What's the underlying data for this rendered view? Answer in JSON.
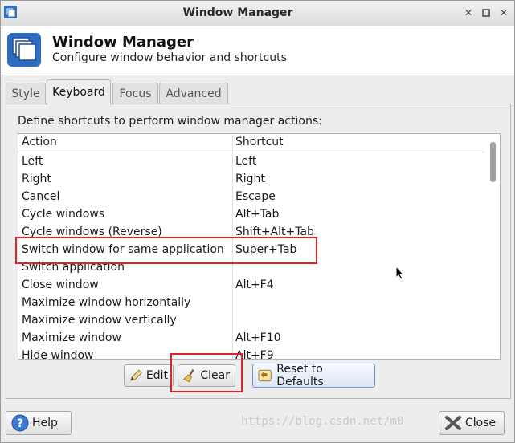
{
  "window": {
    "title": "Window Manager",
    "controls": [
      "minimize-icon",
      "maximize-icon",
      "close-icon"
    ]
  },
  "header": {
    "title": "Window Manager",
    "subtitle": "Configure window behavior and shortcuts"
  },
  "tabs": [
    {
      "label": "Style",
      "active": false
    },
    {
      "label": "Keyboard",
      "active": true
    },
    {
      "label": "Focus",
      "active": false
    },
    {
      "label": "Advanced",
      "active": false
    }
  ],
  "keyboard": {
    "description": "Define shortcuts to perform window manager actions:",
    "columns": {
      "action": "Action",
      "shortcut": "Shortcut"
    },
    "rows": [
      {
        "action": "Left",
        "shortcut": "Left"
      },
      {
        "action": "Right",
        "shortcut": "Right"
      },
      {
        "action": "Cancel",
        "shortcut": "Escape"
      },
      {
        "action": "Cycle windows",
        "shortcut": "Alt+Tab"
      },
      {
        "action": "Cycle windows (Reverse)",
        "shortcut": "Shift+Alt+Tab"
      },
      {
        "action": "Switch window for same application",
        "shortcut": "Super+Tab"
      },
      {
        "action": "Switch application",
        "shortcut": ""
      },
      {
        "action": "Close window",
        "shortcut": "Alt+F4"
      },
      {
        "action": "Maximize window horizontally",
        "shortcut": ""
      },
      {
        "action": "Maximize window vertically",
        "shortcut": ""
      },
      {
        "action": "Maximize window",
        "shortcut": "Alt+F10"
      },
      {
        "action": "Hide window",
        "shortcut": "Alt+F9"
      }
    ],
    "buttons": {
      "edit": "Edit",
      "clear": "Clear",
      "reset": "Reset to Defaults"
    }
  },
  "footer": {
    "help": "Help",
    "close": "Close"
  },
  "watermark": "https://blog.csdn.net/m0"
}
